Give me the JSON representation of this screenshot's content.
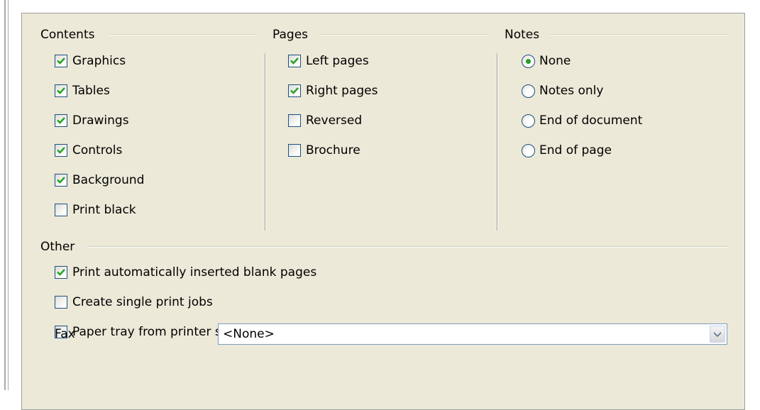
{
  "contents": {
    "title": "Contents",
    "items": [
      {
        "label": "Graphics",
        "checked": true
      },
      {
        "label": "Tables",
        "checked": true
      },
      {
        "label": "Drawings",
        "checked": true
      },
      {
        "label": "Controls",
        "checked": true
      },
      {
        "label": "Background",
        "checked": true
      },
      {
        "label": "Print black",
        "checked": false
      }
    ]
  },
  "pages": {
    "title": "Pages",
    "items": [
      {
        "label": "Left pages",
        "checked": true
      },
      {
        "label": "Right pages",
        "checked": true
      },
      {
        "label": "Reversed",
        "checked": false
      },
      {
        "label": "Brochure",
        "checked": false
      }
    ]
  },
  "notes": {
    "title": "Notes",
    "items": [
      {
        "label": "None",
        "selected": true
      },
      {
        "label": "Notes only",
        "selected": false
      },
      {
        "label": "End of document",
        "selected": false
      },
      {
        "label": "End of page",
        "selected": false
      }
    ]
  },
  "other": {
    "title": "Other",
    "items": [
      {
        "label": "Print automatically inserted blank pages",
        "checked": true
      },
      {
        "label": "Create single print jobs",
        "checked": false
      },
      {
        "label": "Paper tray from printer settings",
        "checked": false
      }
    ]
  },
  "fax": {
    "label": "Fax",
    "value": "<None>"
  },
  "colors": {
    "panel_bg": "#ece9d8",
    "check_mark": "#21a121",
    "control_border": "#1c5180"
  }
}
